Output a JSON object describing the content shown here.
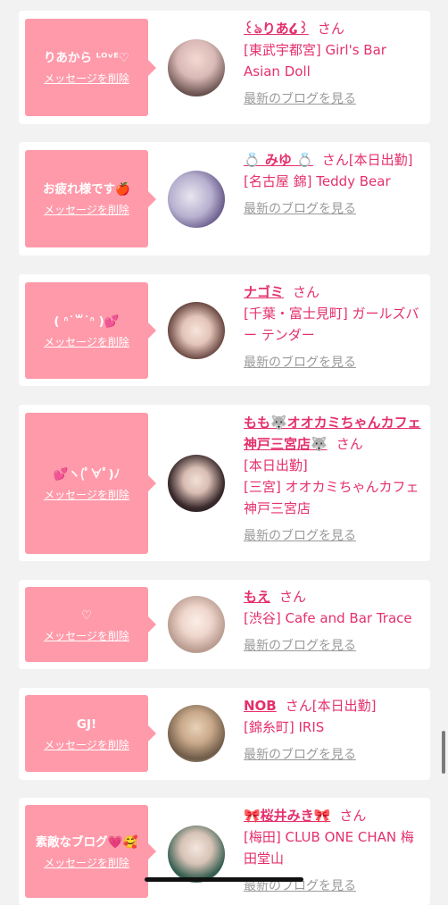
{
  "delete_label": "メッセージを削除",
  "blog_label": "最新のブログを見る",
  "san_label": "さん",
  "colors": {
    "accent": "#e4306b",
    "bubble": "#ff9aaa",
    "link_gray": "#9a9a9a"
  },
  "cards": [
    {
      "message": "りあから ᴸᴼᵛᴱ♡",
      "name": "꒰ঌりあ໒꒱",
      "status": "",
      "shop": "[東武宇都宮] Girl's Bar Asian Doll"
    },
    {
      "message": "お疲れ様です🍎",
      "name": "💍 みゆ 💍",
      "status": "[本日出勤]",
      "shop": "[名古屋 錦] Teddy Bear"
    },
    {
      "message": "( ᐢ˙꒳˙ᐢ )💕",
      "name": "ナゴミ",
      "status": "",
      "shop": "[千葉・富士見町] ガールズバー テンダー"
    },
    {
      "message": "💕ヽ(ﾟ∀ﾟ)ﾉ",
      "name": "もも🐺オオカミちゃんカフェ神戸三宮店🐺",
      "status": "[本日出勤]",
      "shop": "[三宮] オオカミちゃんカフェ神戸三宮店"
    },
    {
      "message": "♡",
      "name": "もえ",
      "status": "",
      "shop": "[渋谷] Cafe and Bar Trace"
    },
    {
      "message": "GJ!",
      "name": "NOB",
      "status": "[本日出勤]",
      "shop": "[錦糸町] IRIS"
    },
    {
      "message": "素敵なブログ💗🥰",
      "name": "🎀桜井みき🎀",
      "status": "",
      "shop": "[梅田] CLUB ONE CHAN 梅田堂山"
    }
  ]
}
